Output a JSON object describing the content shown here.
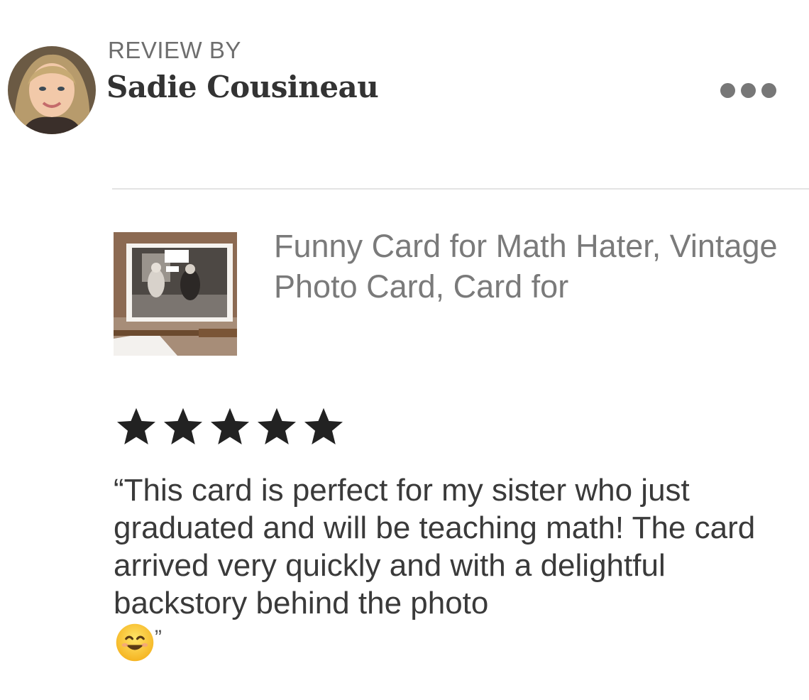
{
  "header": {
    "eyebrow": "REVIEW BY",
    "reviewer_name": "Sadie Cousineau",
    "more_icon": "more-horizontal-icon"
  },
  "listing": {
    "title": "Funny Card for Math Hater, Vintage Photo Card, Card for"
  },
  "rating": {
    "value": 5,
    "max": 5,
    "icon": "star-icon",
    "color": "#222222"
  },
  "review": {
    "text": "“This card is perfect for my sister who just graduated and will be teaching math! The card arrived very quickly and with a delightful backstory behind the photo",
    "emoji": "smiling-face-icon",
    "closing_quote": "”"
  },
  "colors": {
    "muted_text": "#7a7a7a",
    "divider": "#e4e4e4",
    "background": "#ffffff"
  }
}
